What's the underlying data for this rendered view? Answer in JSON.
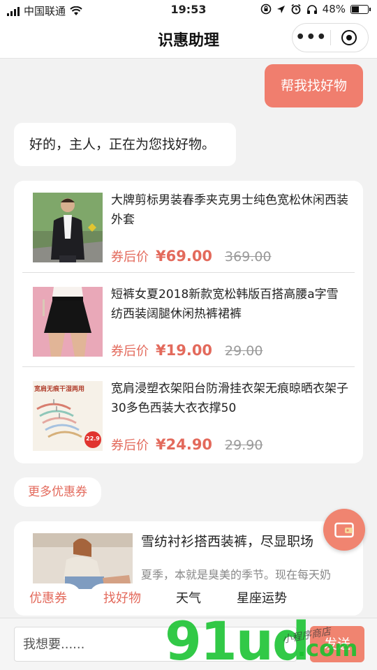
{
  "status_bar": {
    "carrier": "中国联通",
    "time": "19:53",
    "battery_text": "48%",
    "battery_level": 0.48
  },
  "nav": {
    "title": "识惠助理"
  },
  "chat": {
    "user_message": "帮我找好物",
    "bot_reply": "好的，主人，正在为您找好物。"
  },
  "products": [
    {
      "title": "大牌剪标男装春季夹克男士纯色宽松休闲西装外套",
      "coupon_label": "券后价",
      "price": "¥69.00",
      "original_price": "369.00"
    },
    {
      "title": "短裤女夏2018新款宽松韩版百搭高腰a字雪纺西装阔腿休闲热裤裙裤",
      "coupon_label": "券后价",
      "price": "¥19.00",
      "original_price": "29.00"
    },
    {
      "title": "宽肩浸塑衣架阳台防滑挂衣架无痕晾晒衣架子30多色西装大衣衣撑50",
      "coupon_label": "券后价",
      "price": "¥24.90",
      "original_price": "29.90",
      "thumb_text": "宽肩无痕干湿两用",
      "thumb_badge": "22.9"
    }
  ],
  "more_coupons": "更多优惠券",
  "article": {
    "title": "雪纺衬衫搭西装裤，尽显职场",
    "excerpt": "夏季，本就是臭美的季节。现在每天奶"
  },
  "quick_replies": [
    "优惠券",
    "找好物",
    "天气",
    "星座运势"
  ],
  "input": {
    "placeholder": "我想要......",
    "send_label": "发送"
  },
  "watermark": {
    "text": "91ud",
    "suffix": ".com",
    "script": "小程序商店"
  },
  "colors": {
    "accent": "#f07e6e",
    "price": "#e36a5c",
    "watermark": "#16c22e"
  }
}
